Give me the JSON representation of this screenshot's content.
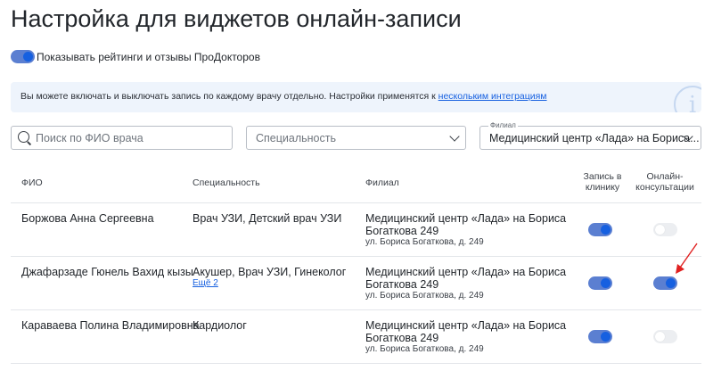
{
  "page": {
    "title": "Настройка для виджетов онлайн-записи"
  },
  "ratings_toggle": {
    "label": "Показывать рейтинги и отзывы ПроДокторов",
    "on": true
  },
  "info_banner": {
    "text": "Вы можете включать и выключать запись по каждому врачу отдельно. Настройки применятся к ",
    "link": "нескольким интеграциям"
  },
  "filters": {
    "search": {
      "placeholder": "Поиск по ФИО врача",
      "value": ""
    },
    "specialty": {
      "placeholder": "Специальность"
    },
    "branch": {
      "caption": "Филиал",
      "value": "Медицинский центр «Лада» на Бориса..."
    }
  },
  "table": {
    "headers": {
      "name": "ФИО",
      "specialty": "Специальность",
      "branch": "Филиал",
      "clinic_booking_1": "Запись в",
      "clinic_booking_2": "клинику",
      "online_1": "Онлайн-",
      "online_2": "консультации"
    },
    "rows": [
      {
        "name": "Боржова Анна Сергеевна",
        "specialty": "Врач УЗИ, Детский врач УЗИ",
        "more": "",
        "branch_line1": "Медицинский центр «Лада» на Бориса",
        "branch_line2": "Богаткова 249",
        "address": "ул. Бориса Богаткова, д. 249",
        "clinic_booking": true,
        "online": false
      },
      {
        "name": "Джафарзаде Гюнель Вахид кызы",
        "specialty": "Акушер, Врач УЗИ, Гинеколог",
        "more": "Ещё 2",
        "branch_line1": "Медицинский центр «Лада» на Бориса",
        "branch_line2": "Богаткова 249",
        "address": "ул. Бориса Богаткова, д. 249",
        "clinic_booking": true,
        "online": true
      },
      {
        "name": "Караваева Полина Владимировна",
        "specialty": "Кардиолог",
        "more": "",
        "branch_line1": "Медицинский центр «Лада» на Бориса",
        "branch_line2": "Богаткова 249",
        "address": "ул. Бориса Богаткова, д. 249",
        "clinic_booking": true,
        "online": false
      }
    ]
  },
  "colors": {
    "accent": "#1660e0",
    "toggle_track_on": "#5b7fd1",
    "annotation_arrow": "#e02020",
    "banner_bg": "#eef4fc"
  }
}
